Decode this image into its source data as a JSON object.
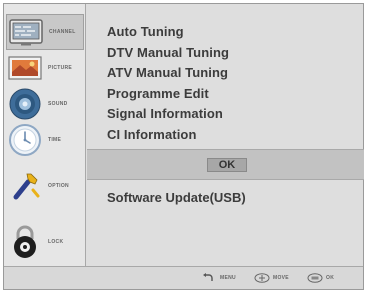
{
  "sidebar": {
    "items": [
      {
        "label": "CHANNEL",
        "icon": "tv-icon",
        "active": true
      },
      {
        "label": "PICTURE",
        "icon": "picture-icon"
      },
      {
        "label": "SOUND",
        "icon": "speaker-icon"
      },
      {
        "label": "TIME",
        "icon": "clock-icon"
      },
      {
        "label": "OPTION",
        "icon": "wrench-icon"
      },
      {
        "label": "LOCK",
        "icon": "lock-icon"
      }
    ]
  },
  "menu": {
    "items": [
      "Auto Tuning",
      "DTV Manual Tuning",
      "ATV Manual Tuning",
      "Programme Edit",
      "Signal Information",
      "CI Information"
    ],
    "ok_label": "OK",
    "software_update": "Software Update(USB)"
  },
  "footer": {
    "hints": [
      {
        "icon": "return-icon",
        "label": "MENU"
      },
      {
        "icon": "dpad-icon",
        "label": "MOVE"
      },
      {
        "icon": "ok-key-icon",
        "label": "OK"
      }
    ]
  }
}
